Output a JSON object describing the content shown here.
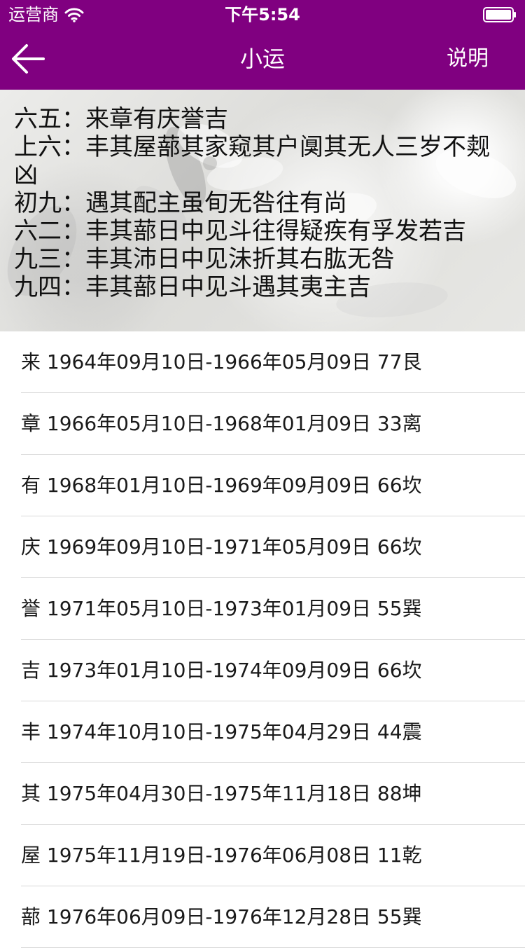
{
  "status_bar": {
    "carrier": "运营商",
    "time": "下午5:54",
    "wifi_icon": "wifi-icon",
    "battery_icon": "battery-icon"
  },
  "nav": {
    "back_icon": "arrow-left-icon",
    "title": "小运",
    "right_label": "说明"
  },
  "colors": {
    "nav_background": "#800080",
    "nav_text": "#ffffff",
    "divider": "#d8d8d8"
  },
  "yao_lines": [
    "六五：来章有庆誉吉",
    "上六：丰其屋蔀其家窥其户阒其无人三岁不觌凶",
    "初九：遇其配主虽旬无咎往有尚",
    "六二：丰其蔀日中见斗往得疑疾有孚发若吉",
    "九三：丰其沛日中见沬折其右肱无咎",
    "九四：丰其蔀日中见斗遇其夷主吉"
  ],
  "year_rows": [
    "来 1964年09月10日-1966年05月09日 77艮",
    "章 1966年05月10日-1968年01月09日 33离",
    "有 1968年01月10日-1969年09月09日 66坎",
    "庆 1969年09月10日-1971年05月09日 66坎",
    "誉 1971年05月10日-1973年01月09日 55巽",
    "吉 1973年01月10日-1974年09月09日 66坎",
    "丰 1974年10月10日-1975年04月29日 44震",
    "其 1975年04月30日-1975年11月18日 88坤",
    "屋 1975年11月19日-1976年06月08日 11乾",
    "蔀 1976年06月09日-1976年12月28日 55巽"
  ]
}
